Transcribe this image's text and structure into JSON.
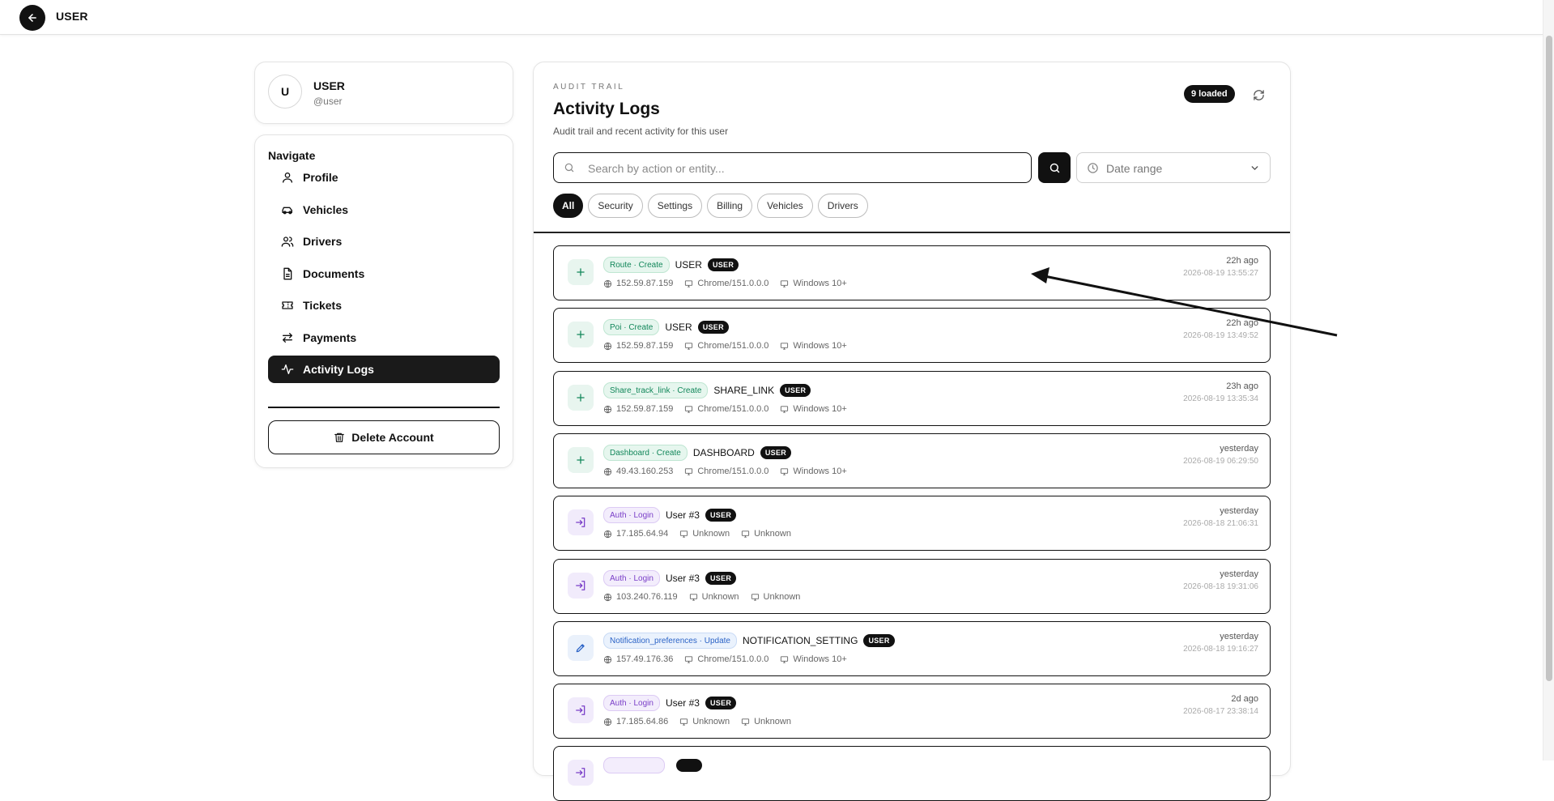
{
  "topbar": {
    "title": "USER"
  },
  "profile": {
    "avatar_letter": "U",
    "name": "USER",
    "handle": "@user"
  },
  "nav": {
    "heading": "Navigate",
    "items": [
      {
        "label": "Profile",
        "icon": "user-icon",
        "active": false
      },
      {
        "label": "Vehicles",
        "icon": "car-icon",
        "active": false
      },
      {
        "label": "Drivers",
        "icon": "users-icon",
        "active": false
      },
      {
        "label": "Documents",
        "icon": "document-icon",
        "active": false
      },
      {
        "label": "Tickets",
        "icon": "ticket-icon",
        "active": false
      },
      {
        "label": "Payments",
        "icon": "arrows-exchange-icon",
        "active": false
      },
      {
        "label": "Activity Logs",
        "icon": "activity-icon",
        "active": true
      }
    ],
    "delete_label": "Delete Account"
  },
  "main": {
    "eyebrow": "AUDIT TRAIL",
    "title": "Activity Logs",
    "subtitle": "Audit trail and recent activity for this user",
    "loaded_badge": "9 loaded",
    "search_placeholder": "Search by action or entity...",
    "search_value": "",
    "date_range_label": "Date range",
    "filters": [
      {
        "label": "All",
        "active": true
      },
      {
        "label": "Security",
        "active": false
      },
      {
        "label": "Settings",
        "active": false
      },
      {
        "label": "Billing",
        "active": false
      },
      {
        "label": "Vehicles",
        "active": false
      },
      {
        "label": "Drivers",
        "active": false
      }
    ]
  },
  "logs": [
    {
      "kind": "create",
      "tag": "Route · Create",
      "entity": "USER",
      "role": "USER",
      "ip": "152.59.87.159",
      "browser": "Chrome/151.0.0.0",
      "os": "Windows 10+",
      "relative": "22h ago",
      "timestamp": "2026-08-19 13:55:27"
    },
    {
      "kind": "create",
      "tag": "Poi · Create",
      "entity": "USER",
      "role": "USER",
      "ip": "152.59.87.159",
      "browser": "Chrome/151.0.0.0",
      "os": "Windows 10+",
      "relative": "22h ago",
      "timestamp": "2026-08-19 13:49:52"
    },
    {
      "kind": "create",
      "tag": "Share_track_link · Create",
      "entity": "SHARE_LINK",
      "role": "USER",
      "ip": "152.59.87.159",
      "browser": "Chrome/151.0.0.0",
      "os": "Windows 10+",
      "relative": "23h ago",
      "timestamp": "2026-08-19 13:35:34"
    },
    {
      "kind": "create",
      "tag": "Dashboard · Create",
      "entity": "DASHBOARD",
      "role": "USER",
      "ip": "49.43.160.253",
      "browser": "Chrome/151.0.0.0",
      "os": "Windows 10+",
      "relative": "yesterday",
      "timestamp": "2026-08-19 06:29:50"
    },
    {
      "kind": "login",
      "tag": "Auth · Login",
      "entity": "User #3",
      "role": "USER",
      "ip": "17.185.64.94",
      "browser": "Unknown",
      "os": "Unknown",
      "relative": "yesterday",
      "timestamp": "2026-08-18 21:06:31"
    },
    {
      "kind": "login",
      "tag": "Auth · Login",
      "entity": "User #3",
      "role": "USER",
      "ip": "103.240.76.119",
      "browser": "Unknown",
      "os": "Unknown",
      "relative": "yesterday",
      "timestamp": "2026-08-18 19:31:06"
    },
    {
      "kind": "update",
      "tag": "Notification_preferences · Update",
      "entity": "NOTIFICATION_SETTING",
      "role": "USER",
      "ip": "157.49.176.36",
      "browser": "Chrome/151.0.0.0",
      "os": "Windows 10+",
      "relative": "yesterday",
      "timestamp": "2026-08-18 19:16:27"
    },
    {
      "kind": "login",
      "tag": "Auth · Login",
      "entity": "User #3",
      "role": "USER",
      "ip": "17.185.64.86",
      "browser": "Unknown",
      "os": "Unknown",
      "relative": "2d ago",
      "timestamp": "2026-08-17 23:38:14"
    },
    {
      "kind": "login",
      "tag": "",
      "entity": "",
      "role": "",
      "ip": "",
      "browser": "",
      "os": "",
      "relative": "",
      "timestamp": ""
    }
  ],
  "colors": {
    "accent": "#111111",
    "create": "#12875a",
    "login": "#7a3fc8",
    "update": "#2b63c6"
  }
}
